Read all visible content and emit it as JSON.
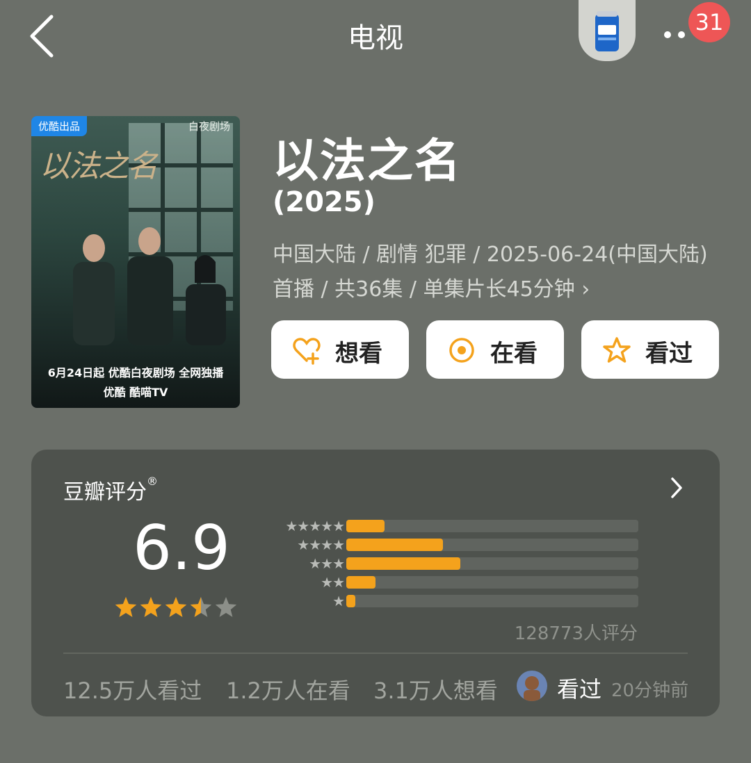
{
  "header": {
    "title": "电视",
    "badge_count": "31"
  },
  "poster": {
    "tag": "优酷出品",
    "brand": "白夜剧场",
    "title_art": "以法之名",
    "date_line": "6月24日起 优酷白夜剧场 全网独播",
    "platform_line": "优酷  酷喵TV"
  },
  "show": {
    "title": "以法之名",
    "year": "(2025)",
    "meta": "中国大陆 / 剧情 犯罪 / 2025-06-24(中国大陆)首播 / 共36集 / 单集片长45分钟 ›"
  },
  "actions": {
    "want": "想看",
    "watching": "在看",
    "watched": "看过"
  },
  "rating": {
    "title": "豆瓣评分",
    "registered_mark": "®",
    "score": "6.9",
    "score_stars": 3.5,
    "distribution": [
      {
        "stars": "★★★★★",
        "fraction": 0.13
      },
      {
        "stars": "★★★★",
        "fraction": 0.33
      },
      {
        "stars": "★★★",
        "fraction": 0.39
      },
      {
        "stars": "★★",
        "fraction": 0.1
      },
      {
        "stars": "★",
        "fraction": 0.03
      }
    ],
    "count": "128773人评分",
    "watched_stat": "12.5万人看过",
    "watching_stat": "1.2万人在看",
    "want_stat": "3.1万人想看",
    "friend_status": "看过",
    "friend_time": "20分钟前"
  },
  "colors": {
    "accent": "#f4a21c",
    "background": "#6b6f69",
    "card": "#4e524d",
    "badge": "#ee5656"
  }
}
